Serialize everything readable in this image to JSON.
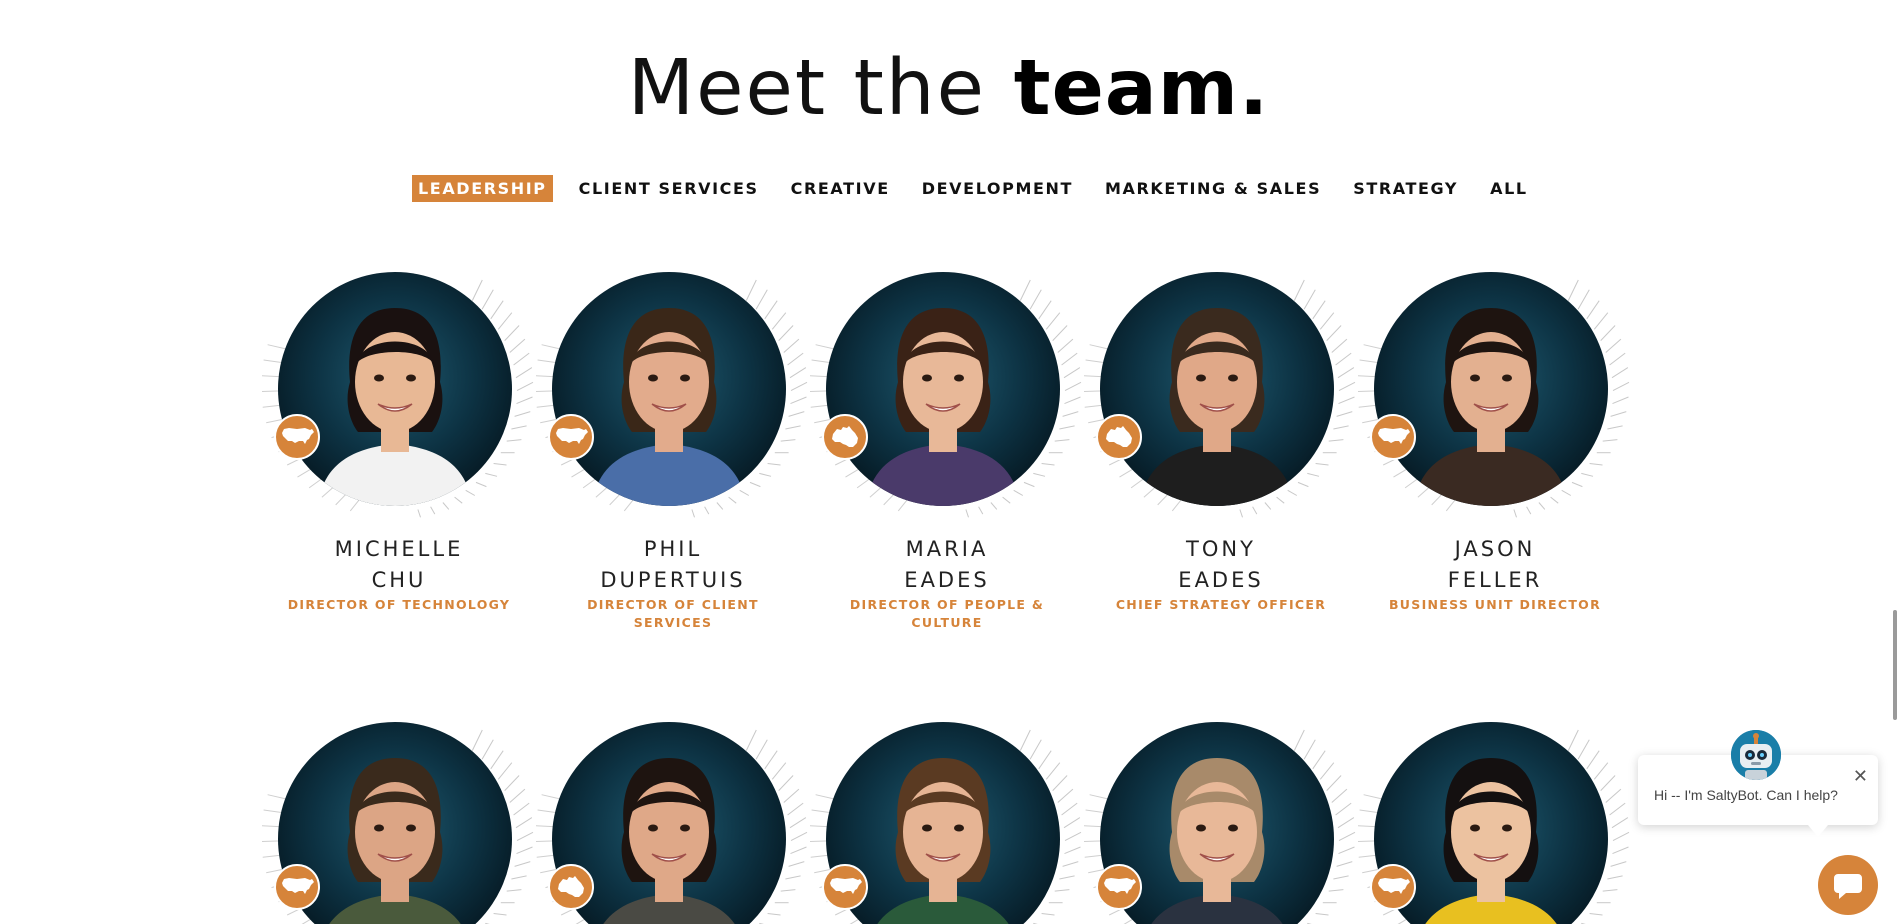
{
  "page": {
    "title_light": "Meet the",
    "title_bold": "team."
  },
  "tabs": [
    {
      "label": "LEADERSHIP",
      "active": true
    },
    {
      "label": "CLIENT SERVICES",
      "active": false
    },
    {
      "label": "CREATIVE",
      "active": false
    },
    {
      "label": "DEVELOPMENT",
      "active": false
    },
    {
      "label": "MARKETING & SALES",
      "active": false
    },
    {
      "label": "STRATEGY",
      "active": false
    },
    {
      "label": "ALL",
      "active": false
    }
  ],
  "team": [
    {
      "first": "MICHELLE",
      "last": "CHU",
      "role": "DIRECTOR OF TECHNOLOGY",
      "badge": "usa-map-icon",
      "skin": "#e8b895",
      "hair": "#1a1110",
      "shirt": "#f2f2f2"
    },
    {
      "first": "PHIL",
      "last": "DUPERTUIS",
      "role": "DIRECTOR OF CLIENT SERVICES",
      "badge": "usa-map-icon",
      "skin": "#e2ab8c",
      "hair": "#3a2718",
      "shirt": "#4a6ea8"
    },
    {
      "first": "MARIA",
      "last": "EADES",
      "role": "DIRECTOR OF PEOPLE & CULTURE",
      "badge": "australia-map-icon",
      "skin": "#e8b898",
      "hair": "#3a2216",
      "shirt": "#4a3a6a"
    },
    {
      "first": "TONY",
      "last": "EADES",
      "role": "CHIEF STRATEGY OFFICER",
      "badge": "australia-map-icon",
      "skin": "#e0a888",
      "hair": "#3a2a1e",
      "shirt": "#1e1e1e"
    },
    {
      "first": "JASON",
      "last": "FELLER",
      "role": "BUSINESS UNIT DIRECTOR",
      "badge": "usa-map-icon",
      "skin": "#e3b090",
      "hair": "#1e1410",
      "shirt": "#3a2a22"
    },
    {
      "first": "",
      "last": "",
      "role": "",
      "badge": "usa-map-icon",
      "skin": "#dca585",
      "hair": "#3a2a1c",
      "shirt": "#4a5a3c"
    },
    {
      "first": "",
      "last": "",
      "role": "",
      "badge": "australia-map-icon",
      "skin": "#dfa888",
      "hair": "#1e1410",
      "shirt": "#4a4a44"
    },
    {
      "first": "",
      "last": "",
      "role": "",
      "badge": "usa-map-icon",
      "skin": "#e6b494",
      "hair": "#5a3a22",
      "shirt": "#2a5a3a"
    },
    {
      "first": "",
      "last": "",
      "role": "",
      "badge": "usa-map-icon",
      "skin": "#e8b898",
      "hair": "#a88a6a",
      "shirt": "#2a3240"
    },
    {
      "first": "",
      "last": "",
      "role": "",
      "badge": "usa-map-icon",
      "skin": "#ecc2a0",
      "hair": "#141010",
      "shirt": "#e8c020"
    }
  ],
  "chat": {
    "message": "Hi -- I'm SaltyBot. Can I help?",
    "close_label": "✕"
  },
  "colors": {
    "accent": "#d6843a",
    "circle_bg": "#0d3344"
  }
}
